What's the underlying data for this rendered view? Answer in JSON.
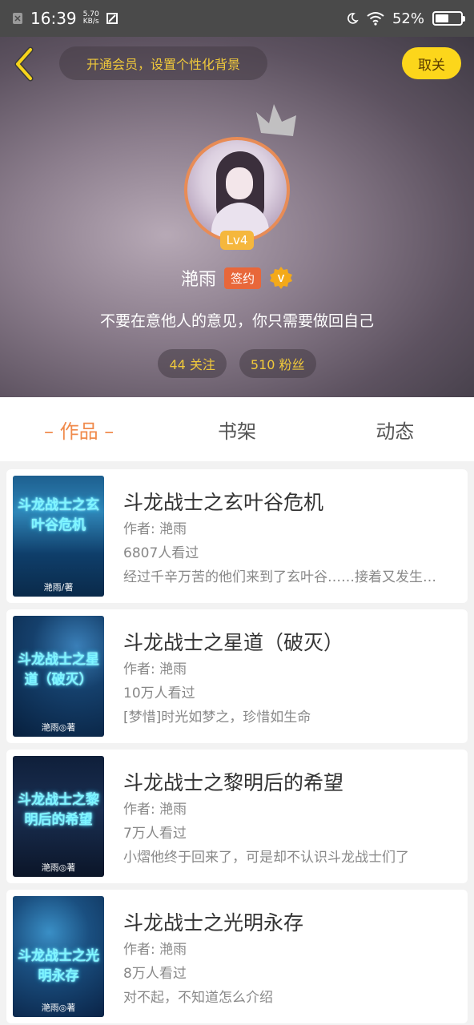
{
  "status_bar": {
    "time": "16:39",
    "speed_top": "5.70",
    "speed_bottom": "KB/s",
    "battery": "52%",
    "battery_level": 0.52
  },
  "header": {
    "promo_text": "开通会员，设置个性化背景",
    "follow_label": "取关",
    "level": "Lv4",
    "username": "滟雨",
    "sign_badge": "签约",
    "bio": "不要在意他人的意见，你只需要做回自己",
    "following": "44 关注",
    "fans": "510 粉丝"
  },
  "tabs": [
    {
      "label": "– 作品 –",
      "active": true
    },
    {
      "label": "书架",
      "active": false
    },
    {
      "label": "动态",
      "active": false
    }
  ],
  "books": [
    {
      "title": "斗龙战士之玄叶谷危机",
      "author": "作者: 滟雨",
      "views": "6807人看过",
      "desc": "经过千辛万苦的他们来到了玄叶谷……接着又发生了什么",
      "cover_title": "斗龙战士之玄叶谷危机",
      "cover_author": "滟雨/著"
    },
    {
      "title": "斗龙战士之星道（破灭）",
      "author": "作者: 滟雨",
      "views": "10万人看过",
      "desc": "[梦惜]时光如梦之，珍惜如生命",
      "cover_title": "斗龙战士之星道（破灭）",
      "cover_author": "滟雨◎著"
    },
    {
      "title": "斗龙战士之黎明后的希望",
      "author": "作者: 滟雨",
      "views": "7万人看过",
      "desc": "小熠他终于回来了，可是却不认识斗龙战士们了",
      "cover_title": "斗龙战士之黎明后的希望",
      "cover_author": "滟雨◎著"
    },
    {
      "title": "斗龙战士之光明永存",
      "author": "作者: 滟雨",
      "views": "8万人看过",
      "desc": "对不起，不知道怎么介绍",
      "cover_title": "斗龙战士之光明永存",
      "cover_author": "滟雨◎著"
    }
  ],
  "colors": {
    "accent": "#f08a4b",
    "follow_button": "#fcd61b",
    "promo_text": "#f0c93b",
    "sign_badge": "#e8673a"
  },
  "icons": {
    "back": "chevron-left-icon",
    "crown": "crown-icon",
    "verified": "v-badge-icon"
  }
}
